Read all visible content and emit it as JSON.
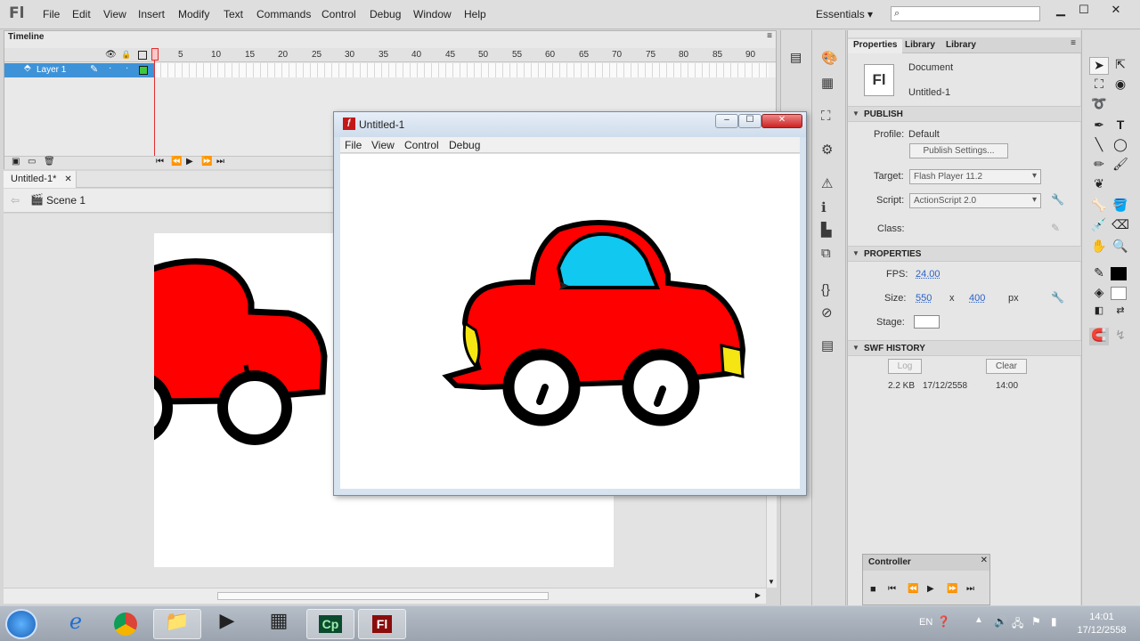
{
  "app": {
    "logo": "Fl"
  },
  "menu": [
    "File",
    "Edit",
    "View",
    "Insert",
    "Modify",
    "Text",
    "Commands",
    "Control",
    "Debug",
    "Window",
    "Help"
  ],
  "workspace": {
    "label": "Essentials"
  },
  "timeline": {
    "tab": "Timeline",
    "frame_numbers": [
      "1",
      "5",
      "10",
      "15",
      "20",
      "25",
      "30",
      "35",
      "40",
      "45",
      "50",
      "55",
      "60",
      "65",
      "70",
      "75",
      "80",
      "85",
      "90"
    ],
    "layer_name": "Layer 1"
  },
  "document": {
    "tab": "Untitled-1*",
    "scene": "Scene 1"
  },
  "properties": {
    "tabs": [
      "Properties",
      "Library",
      "Library"
    ],
    "doc_type": "Document",
    "doc_name": "Untitled-1",
    "doc_icon": "Fl",
    "publish": {
      "header": "PUBLISH",
      "profile_label": "Profile:",
      "profile_value": "Default",
      "settings_button": "Publish Settings...",
      "target_label": "Target:",
      "target_value": "Flash Player 11.2",
      "script_label": "Script:",
      "script_value": "ActionScript 2.0",
      "class_label": "Class:"
    },
    "props": {
      "header": "PROPERTIES",
      "fps_label": "FPS:",
      "fps_value": "24.00",
      "size_label": "Size:",
      "width": "550",
      "x": "x",
      "height": "400",
      "unit": "px",
      "stage_label": "Stage:",
      "stage_color": "#ffffff"
    },
    "swf_history": {
      "header": "SWF HISTORY",
      "log_button": "Log",
      "clear_button": "Clear",
      "size": "2.2 KB",
      "date": "17/12/2558",
      "time": "14:00"
    }
  },
  "controller": {
    "title": "Controller"
  },
  "swf_window": {
    "title": "Untitled-1",
    "menu": [
      "File",
      "View",
      "Control",
      "Debug"
    ]
  },
  "car": {
    "body": "#ff0000",
    "window": "#10c8f0",
    "light": "#f5e613",
    "wheel": "#000000"
  },
  "taskbar": {
    "language": "EN",
    "time": "14:01",
    "date": "17/12/2558"
  }
}
